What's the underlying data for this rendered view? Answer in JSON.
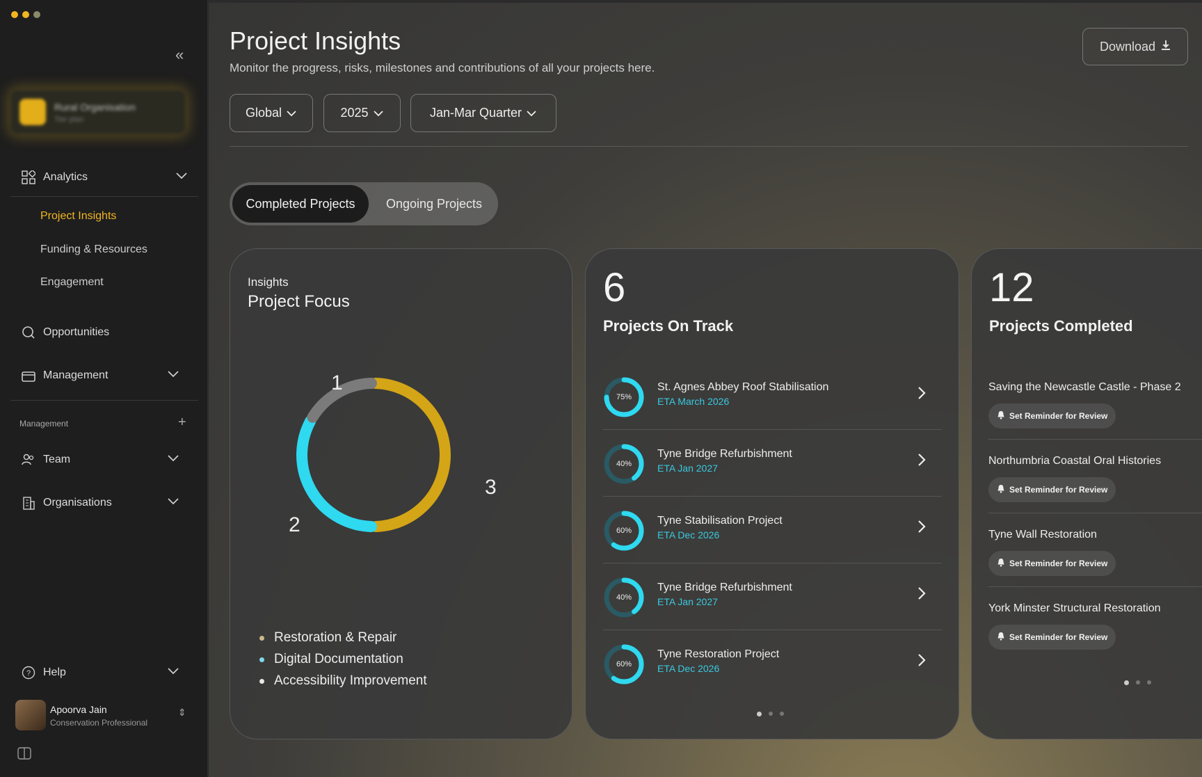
{
  "sidebar": {
    "org": {
      "name": "Rural Organisation",
      "sub": "Tier plan"
    },
    "analytics_label": "Analytics",
    "analytics_items": [
      {
        "label": "Project Insights",
        "active": true
      },
      {
        "label": "Funding & Resources",
        "active": false
      },
      {
        "label": "Engagement",
        "active": false
      }
    ],
    "opportunities_label": "Opportunities",
    "management_label": "Management",
    "section_label": "Management",
    "team_label": "Team",
    "organisations_label": "Organisations",
    "help_label": "Help",
    "user": {
      "name": "Apoorva Jain",
      "role": "Conservation Professional"
    }
  },
  "header": {
    "title": "Project Insights",
    "subtitle": "Monitor the progress, risks, milestones and contributions of all your projects here.",
    "download_label": "Download"
  },
  "filters": [
    {
      "label": "Global"
    },
    {
      "label": "2025"
    },
    {
      "label": "Jan-Mar Quarter"
    }
  ],
  "tabs": {
    "active": "Completed Projects",
    "inactive": "Ongoing Projects"
  },
  "focus_card": {
    "label": "Insights",
    "title": "Project Focus",
    "segments": [
      {
        "name": "Restoration & Repair",
        "value": 3,
        "color": "#d4a516"
      },
      {
        "name": "Digital Documentation",
        "value": 2,
        "color": "#2fd9f0"
      },
      {
        "name": "Accessibility Improvement",
        "value": 1,
        "color": "#7b7b7b"
      }
    ],
    "segment_labels": [
      "1",
      "2",
      "3"
    ],
    "legend": [
      {
        "name": "Restoration & Repair",
        "color": "#c9b98a"
      },
      {
        "name": "Digital Documentation",
        "color": "#7fd8e8"
      },
      {
        "name": "Accessibility Improvement",
        "color": "#e8e8e8"
      }
    ]
  },
  "on_track": {
    "count": "6",
    "title": "Projects On Track",
    "projects": [
      {
        "name": "St. Agnes Abbey Roof Stabilisation",
        "eta": "ETA March 2026",
        "progress": 75,
        "progress_label": "75%"
      },
      {
        "name": "Tyne Bridge Refurbishment",
        "eta": "ETA Jan 2027",
        "progress": 40,
        "progress_label": "40%"
      },
      {
        "name": "Tyne Stabilisation Project",
        "eta": "ETA Dec 2026",
        "progress": 60,
        "progress_label": "60%"
      },
      {
        "name": "Tyne Bridge Refurbishment",
        "eta": "ETA Jan 2027",
        "progress": 40,
        "progress_label": "40%"
      },
      {
        "name": "Tyne Restoration Project",
        "eta": "ETA Dec 2026",
        "progress": 60,
        "progress_label": "60%"
      }
    ]
  },
  "completed": {
    "count": "12",
    "title": "Projects Completed",
    "reminder_label": "Set Reminder for Review",
    "projects": [
      {
        "name": "Saving the Newcastle Castle - Phase 2"
      },
      {
        "name": "Northumbria Coastal Oral Histories"
      },
      {
        "name": "Tyne Wall Restoration"
      },
      {
        "name": "York Minster Structural Restoration"
      }
    ]
  },
  "colors": {
    "accent": "#f2b622",
    "cyan": "#2fd9f0",
    "gold": "#d4a516"
  },
  "icons": {
    "collapse": "chevrons-left-icon",
    "download": "download-icon",
    "analytics": "grid-icon",
    "search": "search-icon",
    "management": "briefcase-icon",
    "team": "users-icon",
    "organisations": "building-icon",
    "help": "help-icon",
    "bell": "bell-icon"
  }
}
